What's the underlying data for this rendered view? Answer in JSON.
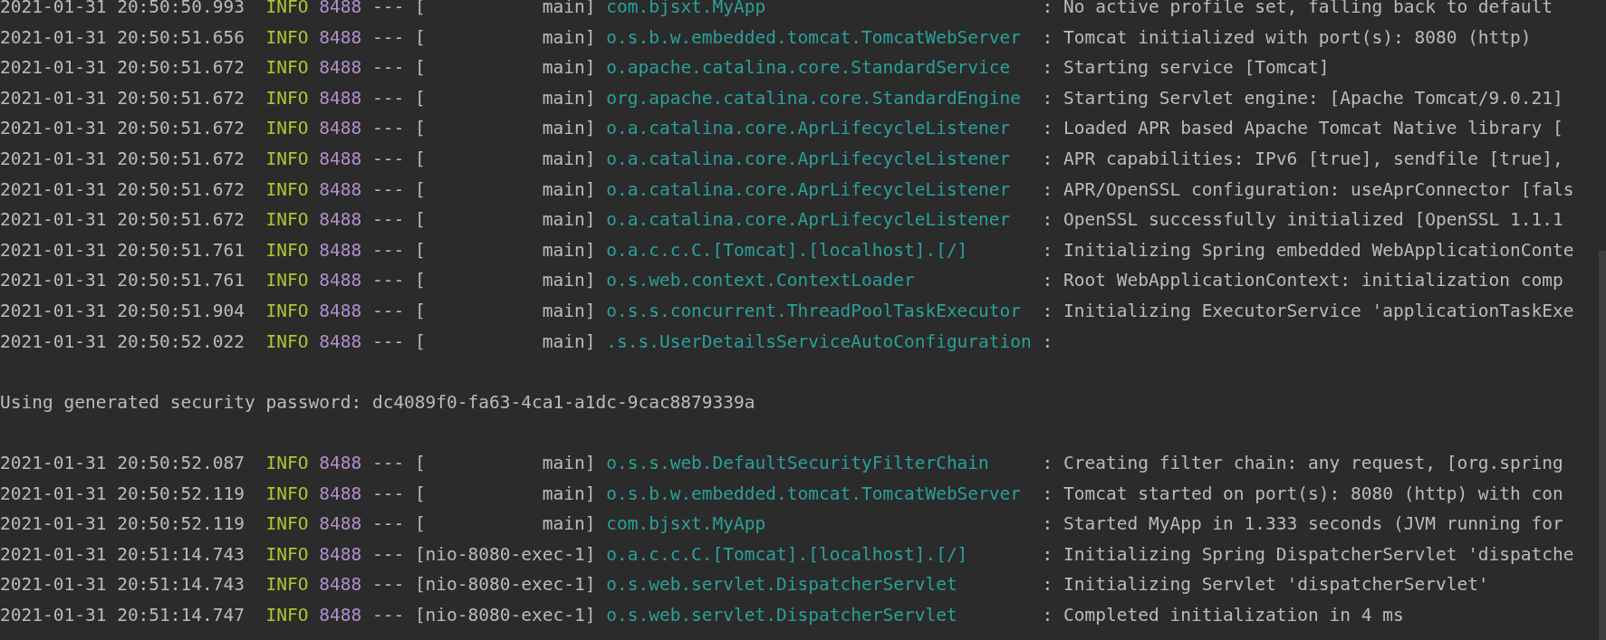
{
  "console": {
    "lines": [
      {
        "kind": "log",
        "time": "2021-01-31 20:50:50.993",
        "level": "INFO",
        "pid": "8488",
        "separator": "---",
        "thread": "[           main]",
        "logger": "com.bjsxt.MyApp",
        "message": ": No active profile set, falling back to default"
      },
      {
        "kind": "log",
        "time": "2021-01-31 20:50:51.656",
        "level": "INFO",
        "pid": "8488",
        "separator": "---",
        "thread": "[           main]",
        "logger": "o.s.b.w.embedded.tomcat.TomcatWebServer",
        "message": ": Tomcat initialized with port(s): 8080 (http)"
      },
      {
        "kind": "log",
        "time": "2021-01-31 20:50:51.672",
        "level": "INFO",
        "pid": "8488",
        "separator": "---",
        "thread": "[           main]",
        "logger": "o.apache.catalina.core.StandardService",
        "message": ": Starting service [Tomcat]"
      },
      {
        "kind": "log",
        "time": "2021-01-31 20:50:51.672",
        "level": "INFO",
        "pid": "8488",
        "separator": "---",
        "thread": "[           main]",
        "logger": "org.apache.catalina.core.StandardEngine",
        "message": ": Starting Servlet engine: [Apache Tomcat/9.0.21]"
      },
      {
        "kind": "log",
        "time": "2021-01-31 20:50:51.672",
        "level": "INFO",
        "pid": "8488",
        "separator": "---",
        "thread": "[           main]",
        "logger": "o.a.catalina.core.AprLifecycleListener",
        "message": ": Loaded APR based Apache Tomcat Native library ["
      },
      {
        "kind": "log",
        "time": "2021-01-31 20:50:51.672",
        "level": "INFO",
        "pid": "8488",
        "separator": "---",
        "thread": "[           main]",
        "logger": "o.a.catalina.core.AprLifecycleListener",
        "message": ": APR capabilities: IPv6 [true], sendfile [true],"
      },
      {
        "kind": "log",
        "time": "2021-01-31 20:50:51.672",
        "level": "INFO",
        "pid": "8488",
        "separator": "---",
        "thread": "[           main]",
        "logger": "o.a.catalina.core.AprLifecycleListener",
        "message": ": APR/OpenSSL configuration: useAprConnector [fals"
      },
      {
        "kind": "log",
        "time": "2021-01-31 20:50:51.672",
        "level": "INFO",
        "pid": "8488",
        "separator": "---",
        "thread": "[           main]",
        "logger": "o.a.catalina.core.AprLifecycleListener",
        "message": ": OpenSSL successfully initialized [OpenSSL 1.1.1"
      },
      {
        "kind": "log",
        "time": "2021-01-31 20:50:51.761",
        "level": "INFO",
        "pid": "8488",
        "separator": "---",
        "thread": "[           main]",
        "logger": "o.a.c.c.C.[Tomcat].[localhost].[/]",
        "message": ": Initializing Spring embedded WebApplicationConte"
      },
      {
        "kind": "log",
        "time": "2021-01-31 20:50:51.761",
        "level": "INFO",
        "pid": "8488",
        "separator": "---",
        "thread": "[           main]",
        "logger": "o.s.web.context.ContextLoader",
        "message": ": Root WebApplicationContext: initialization comp"
      },
      {
        "kind": "log",
        "time": "2021-01-31 20:50:51.904",
        "level": "INFO",
        "pid": "8488",
        "separator": "---",
        "thread": "[           main]",
        "logger": "o.s.s.concurrent.ThreadPoolTaskExecutor",
        "message": ": Initializing ExecutorService 'applicationTaskExe"
      },
      {
        "kind": "log",
        "time": "2021-01-31 20:50:52.022",
        "level": "INFO",
        "pid": "8488",
        "separator": "---",
        "thread": "[           main]",
        "logger": ".s.s.UserDetailsServiceAutoConfiguration",
        "message": ":"
      },
      {
        "kind": "blank"
      },
      {
        "kind": "plain",
        "text": "Using generated security password: dc4089f0-fa63-4ca1-a1dc-9cac8879339a"
      },
      {
        "kind": "blank"
      },
      {
        "kind": "log",
        "time": "2021-01-31 20:50:52.087",
        "level": "INFO",
        "pid": "8488",
        "separator": "---",
        "thread": "[           main]",
        "logger": "o.s.s.web.DefaultSecurityFilterChain",
        "message": ": Creating filter chain: any request, [org.spring"
      },
      {
        "kind": "log",
        "time": "2021-01-31 20:50:52.119",
        "level": "INFO",
        "pid": "8488",
        "separator": "---",
        "thread": "[           main]",
        "logger": "o.s.b.w.embedded.tomcat.TomcatWebServer",
        "message": ": Tomcat started on port(s): 8080 (http) with con"
      },
      {
        "kind": "log",
        "time": "2021-01-31 20:50:52.119",
        "level": "INFO",
        "pid": "8488",
        "separator": "---",
        "thread": "[           main]",
        "logger": "com.bjsxt.MyApp",
        "message": ": Started MyApp in 1.333 seconds (JVM running for"
      },
      {
        "kind": "log",
        "time": "2021-01-31 20:51:14.743",
        "level": "INFO",
        "pid": "8488",
        "separator": "---",
        "thread": "[nio-8080-exec-1]",
        "logger": "o.a.c.c.C.[Tomcat].[localhost].[/]",
        "message": ": Initializing Spring DispatcherServlet 'dispatche"
      },
      {
        "kind": "log",
        "time": "2021-01-31 20:51:14.743",
        "level": "INFO",
        "pid": "8488",
        "separator": "---",
        "thread": "[nio-8080-exec-1]",
        "logger": "o.s.web.servlet.DispatcherServlet",
        "message": ": Initializing Servlet 'dispatcherServlet'"
      },
      {
        "kind": "log",
        "time": "2021-01-31 20:51:14.747",
        "level": "INFO",
        "pid": "8488",
        "separator": "---",
        "thread": "[nio-8080-exec-1]",
        "logger": "o.s.web.servlet.DispatcherServlet",
        "message": ": Completed initialization in 4 ms"
      }
    ]
  }
}
